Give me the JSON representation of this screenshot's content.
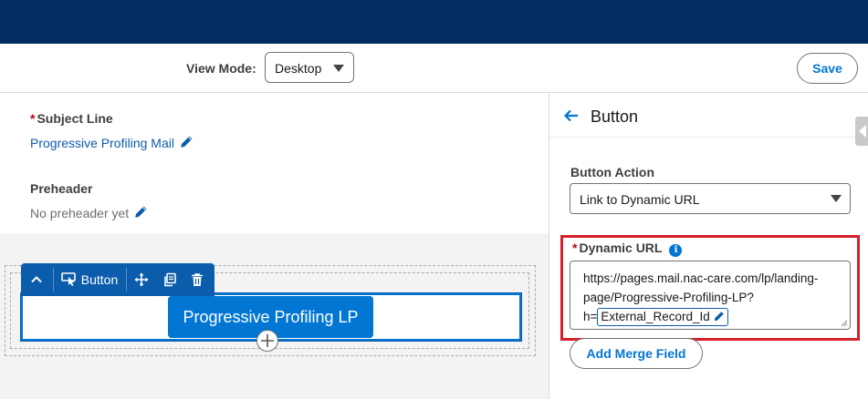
{
  "toolbar": {
    "view_mode_label": "View Mode:",
    "view_mode_value": "Desktop",
    "save_label": "Save"
  },
  "email_settings": {
    "subject_required": "*",
    "subject_label": "Subject Line",
    "subject_value": "Progressive Profiling Mail",
    "preheader_label": "Preheader",
    "preheader_value": "No preheader yet"
  },
  "canvas": {
    "block_toolbar_label": "Button",
    "button_text": "Progressive Profiling LP"
  },
  "panel": {
    "title": "Button",
    "button_action_label": "Button Action",
    "button_action_value": "Link to Dynamic URL",
    "dynamic_url_required": "*",
    "dynamic_url_label": "Dynamic URL",
    "dynamic_url_line1": "https://pages.mail.nac-care.com/lp/landing-",
    "dynamic_url_line2": "page/Progressive-Profiling-LP?",
    "dynamic_url_line3_prefix": "h=",
    "merge_field_token": "External_Record_Id",
    "add_merge_field_label": "Add Merge Field"
  },
  "colors": {
    "header_bg": "#032d60",
    "brand_blue": "#0176d3",
    "toolbar_blue": "#0b5cab",
    "highlight_red": "#d4202a"
  }
}
